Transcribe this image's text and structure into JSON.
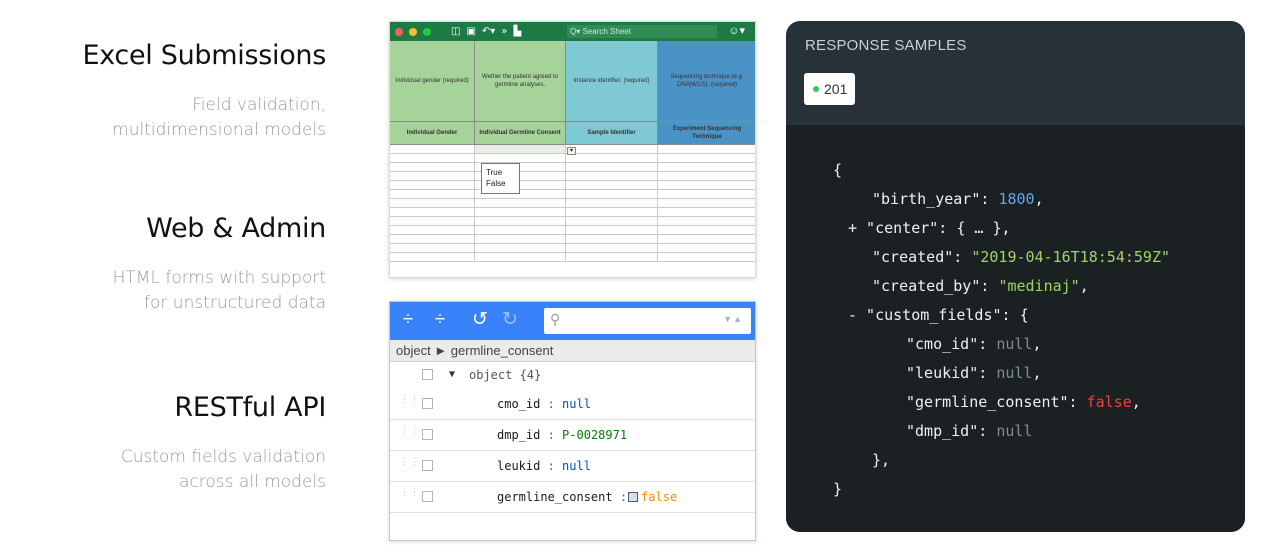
{
  "features": [
    {
      "title": "Excel Submissions",
      "desc_1": "Field validation,",
      "desc_2": "multidimensional models"
    },
    {
      "title": "Web & Admin",
      "desc_1": "HTML forms with support",
      "desc_2": "for unstructured data"
    },
    {
      "title": "RESTful API",
      "desc_1": "Custom fields validation",
      "desc_2": "across all models"
    }
  ],
  "excel": {
    "search_placeholder": "Search Sheet",
    "header_descriptions": [
      "Individual gender (required)",
      "Wether the patient agreed to germline analyses.",
      "Instance identifier. (required)",
      "Sequencing technique (e.g. DNA|WGS). (required)"
    ],
    "column_labels": [
      "Individual Gender",
      "Individual Germline Consent",
      "Sample Identifier",
      "Experiment Sequencing Technique"
    ],
    "dropdown_options": [
      "True",
      "False"
    ],
    "colors": {
      "toolbar": "#1e7a45",
      "green": "#a6d39a",
      "teal": "#7ec9d3",
      "blue": "#4b93c7"
    }
  },
  "tree": {
    "breadcrumb": "object ► germline_consent",
    "root_label": "object {4}",
    "rows": [
      {
        "key": "cmo_id",
        "value": "null",
        "type": "null"
      },
      {
        "key": "dmp_id",
        "value": "P-0028971",
        "type": "string"
      },
      {
        "key": "leukid",
        "value": "null",
        "type": "null"
      },
      {
        "key": "germline_consent",
        "value": "false",
        "type": "boolean"
      }
    ],
    "colors": {
      "toolbar": "#3883fa"
    }
  },
  "response": {
    "title": "RESPONSE SAMPLES",
    "status": "201",
    "code": {
      "open": "{",
      "birth_year_key": "\"birth_year\": ",
      "birth_year_val": "1800",
      "center_line": "+ \"center\": { … },",
      "created_key": "\"created\": ",
      "created_val": "\"2019-04-16T18:54:59Z\"",
      "created_by_key": "\"created_by\": ",
      "created_by_val": "\"medinaj\"",
      "custom_fields_line": "- \"custom_fields\": {",
      "cmo_id_key": "\"cmo_id\": ",
      "leukid_key": "\"leukid\": ",
      "germline_key": "\"germline_consent\": ",
      "dmp_id_key": "\"dmp_id\": ",
      "null_val": "null",
      "false_val": "false",
      "inner_close": "},",
      "close": "}"
    },
    "colors": {
      "panel": "#263238",
      "code_bg": "#1b2023",
      "number": "#66a6e6",
      "string": "#a0d468",
      "null": "#7e8c93",
      "false": "#f0403d"
    }
  }
}
